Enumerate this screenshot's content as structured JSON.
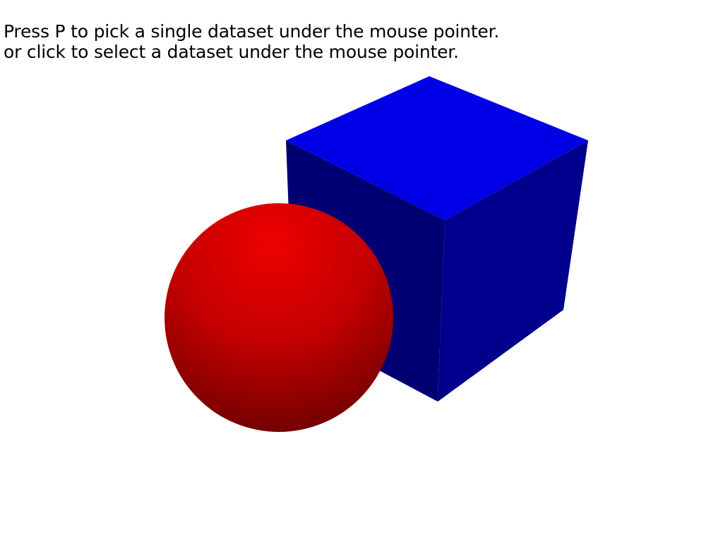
{
  "viewport": {
    "background": "#ffffff"
  },
  "instructions": {
    "line1": "Press P to pick a single dataset under the mouse pointer.",
    "line2": "or click to select a dataset under the mouse pointer."
  },
  "scene": {
    "cube": {
      "colors": {
        "top": "#0000e6",
        "left": "#000073",
        "right": "#00008c"
      }
    },
    "sphere": {
      "colors": {
        "highlight": "#ee0000",
        "mid": "#c40000",
        "shadow": "#5a0000"
      }
    }
  }
}
